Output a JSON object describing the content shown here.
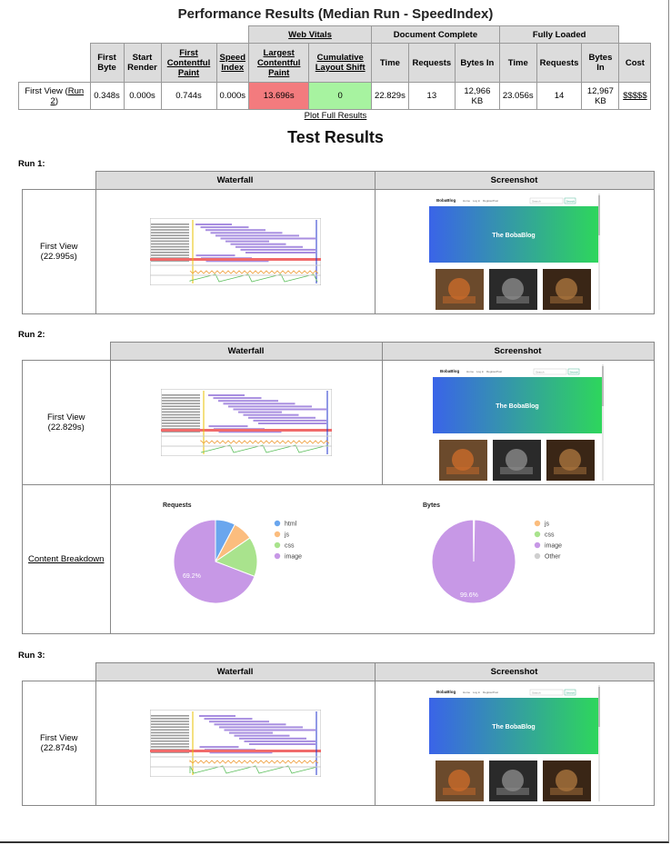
{
  "perf": {
    "title": "Performance Results (Median Run - SpeedIndex)",
    "groups": {
      "web_vitals": "Web Vitals",
      "doc_complete": "Document Complete",
      "fully_loaded": "Fully Loaded"
    },
    "headers": {
      "first_byte": "First Byte",
      "start_render": "Start Render",
      "fcp": "First Contentful Paint",
      "speed_index": "Speed Index",
      "lcp": "Largest Contentful Paint",
      "cls": "Cumulative Layout Shift",
      "dc_time": "Time",
      "dc_requests": "Requests",
      "dc_bytes": "Bytes In",
      "fl_time": "Time",
      "fl_requests": "Requests",
      "fl_bytes": "Bytes In",
      "cost": "Cost"
    },
    "row": {
      "label_prefix": "First View (",
      "label_link": "Run 2",
      "label_suffix": ")",
      "first_byte": "0.348s",
      "start_render": "0.000s",
      "fcp": "0.744s",
      "speed_index": "0.000s",
      "lcp": "13.696s",
      "cls": "0",
      "dc_time": "22.829s",
      "dc_requests": "13",
      "dc_bytes": "12,966 KB",
      "fl_time": "23.056s",
      "fl_requests": "14",
      "fl_bytes": "12,967 KB",
      "cost": "$$$$$"
    },
    "colors": {
      "lcp_bad": "#f37b7e",
      "cls_good": "#a7f3a0"
    }
  },
  "plot_link": "Plot Full Results",
  "test_results_title": "Test Results",
  "runs": [
    {
      "label": "Run 1:",
      "waterfall_header": "Waterfall",
      "screenshot_header": "Screenshot",
      "view": "First View",
      "time": "(22.995s)"
    },
    {
      "label": "Run 2:",
      "waterfall_header": "Waterfall",
      "screenshot_header": "Screenshot",
      "view": "First View",
      "time": "(22.829s)"
    },
    {
      "label": "Run 3:",
      "waterfall_header": "Waterfall",
      "screenshot_header": "Screenshot",
      "view": "First View",
      "time": "(22.874s)"
    }
  ],
  "screenshot": {
    "brand": "BobaBlog",
    "nav": [
      "Home",
      "Log in",
      "Register",
      "Post"
    ],
    "search_placeholder": "Search",
    "search_button": "Search",
    "hero_title": "The BobaBlog",
    "colors": {
      "hero_start": "#3a64e8",
      "hero_end": "#2ed65c"
    }
  },
  "breakdown": {
    "link": "Content Breakdown",
    "requests": {
      "title": "Requests",
      "legend": [
        "html",
        "js",
        "css",
        "image"
      ],
      "slice_label": "69.2%"
    },
    "bytes": {
      "title": "Bytes",
      "legend": [
        "js",
        "css",
        "image",
        "Other"
      ],
      "slice_label": "99.6%"
    },
    "colors": {
      "html": "#6aa6ee",
      "js": "#fbbd7e",
      "css": "#a9e38d",
      "image": "#c798e6",
      "other": "#cfcfcf"
    }
  },
  "chart_data": [
    {
      "type": "pie",
      "title": "Requests",
      "categories": [
        "html",
        "js",
        "css",
        "image"
      ],
      "values": [
        7.7,
        7.7,
        15.4,
        69.2
      ]
    },
    {
      "type": "pie",
      "title": "Bytes",
      "categories": [
        "js",
        "css",
        "image",
        "Other"
      ],
      "values": [
        0.2,
        0.1,
        99.6,
        0.1
      ]
    }
  ]
}
